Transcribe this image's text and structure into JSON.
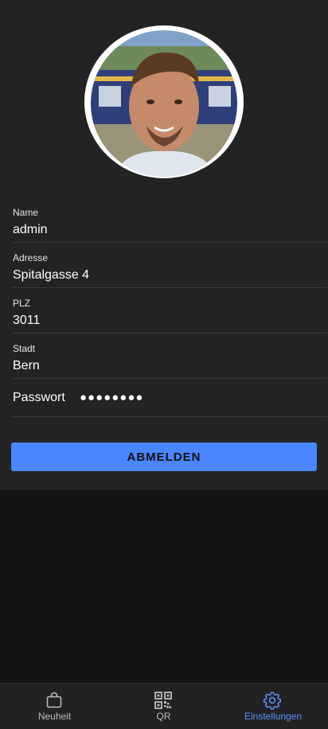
{
  "profile": {
    "fields": [
      {
        "label": "Name",
        "value": "admin"
      },
      {
        "label": "Adresse",
        "value": "Spitalgasse 4"
      },
      {
        "label": "PLZ",
        "value": "3011"
      },
      {
        "label": "Stadt",
        "value": "Bern"
      }
    ],
    "password": {
      "label": "Passwort",
      "masked_value": "●●●●●●●●"
    }
  },
  "actions": {
    "logout_label": "ABMELDEN"
  },
  "nav": {
    "items": [
      {
        "label": "Neuheit",
        "icon": "shopping-bag-icon",
        "active": false
      },
      {
        "label": "QR",
        "icon": "qr-code-icon",
        "active": false
      },
      {
        "label": "Einstellungen",
        "icon": "gear-icon",
        "active": true
      }
    ]
  },
  "colors": {
    "accent": "#4a86ff",
    "panel": "#232323",
    "background": "#141414"
  }
}
